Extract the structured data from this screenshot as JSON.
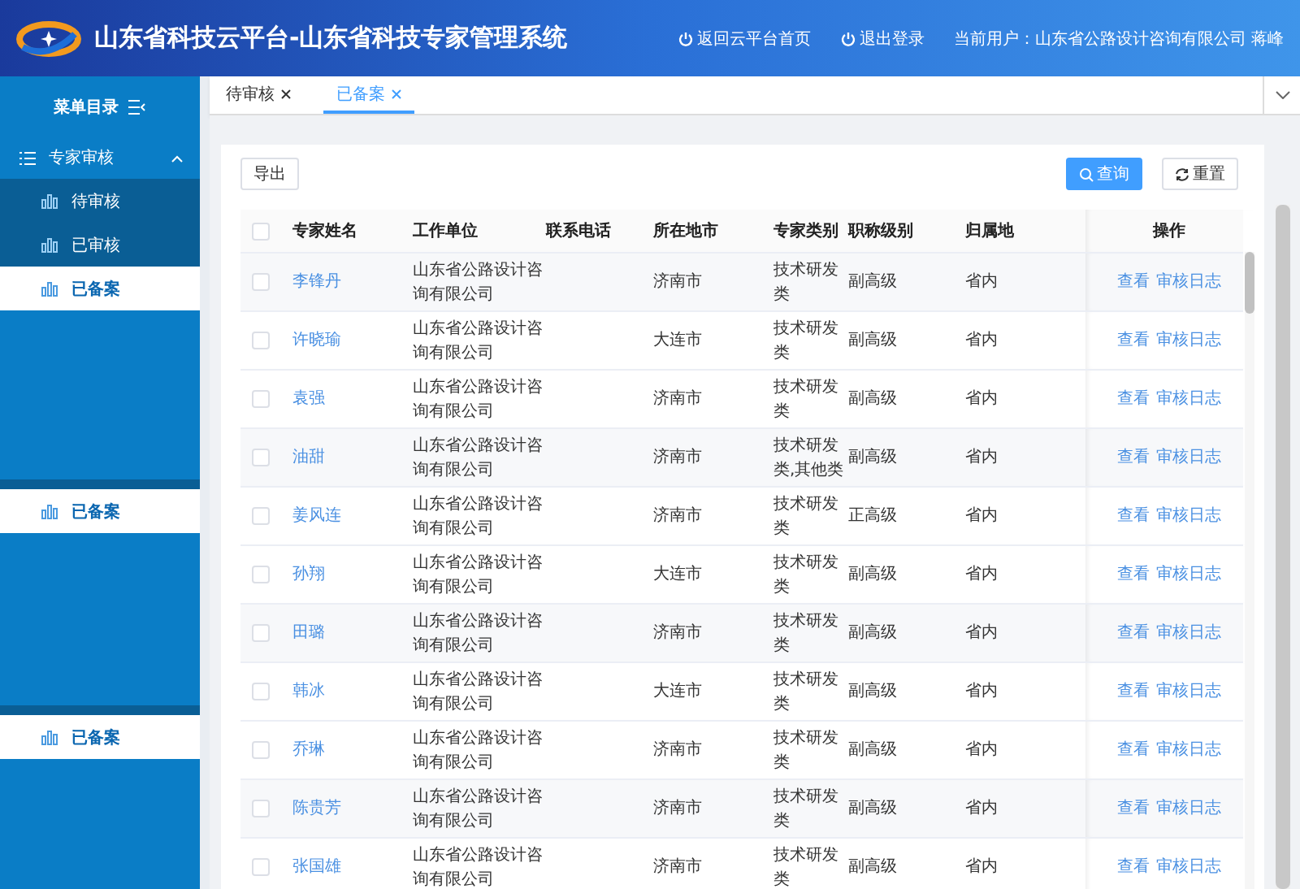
{
  "header": {
    "title": "山东省科技云平台-山东省科技专家管理系统",
    "links": [
      {
        "label": "返回云平台首页"
      },
      {
        "label": "退出登录"
      }
    ],
    "user": "当前用户：山东省公路设计咨询有限公司 蒋峰"
  },
  "sidebar": {
    "title": "菜单目录",
    "groups": [
      {
        "label": "专家审核",
        "expanded": true,
        "children": [
          {
            "label": "待审核",
            "selected": false
          },
          {
            "label": "已审核",
            "selected": false
          },
          {
            "label": "已备案",
            "selected": true
          }
        ]
      }
    ],
    "stray_items": [
      {
        "label": "已备案",
        "selected": true
      },
      {
        "label": "已备案",
        "selected": true
      }
    ]
  },
  "tabs": [
    {
      "label": "待审核",
      "selected": false
    },
    {
      "label": "已备案",
      "selected": true
    }
  ],
  "toolbar": {
    "left": [
      {
        "label": "导出",
        "kind": "plain"
      }
    ],
    "right": [
      {
        "label": "查询",
        "kind": "primary"
      },
      {
        "label": "重置",
        "kind": "reset"
      }
    ]
  },
  "table": {
    "header_checked": false,
    "columns": [
      "专家姓名",
      "工作单位",
      "联系电话",
      "所在地市",
      "专家类别",
      "职称级别",
      "归属地",
      "操作"
    ],
    "rows": [
      {
        "checked": false,
        "name": "李锋丹",
        "unit": "山东省公路设计咨询有限公司",
        "city": "济南市",
        "category": "技术研发类",
        "title": "副高级",
        "region": "省内",
        "actions": [
          "查看",
          "审核日志"
        ]
      },
      {
        "checked": false,
        "name": "许晓瑜",
        "unit": "山东省公路设计咨询有限公司",
        "city": "大连市",
        "category": "技术研发类",
        "title": "副高级",
        "region": "省内",
        "actions": [
          "查看",
          "审核日志"
        ]
      },
      {
        "checked": false,
        "name": "袁强",
        "unit": "山东省公路设计咨询有限公司",
        "city": "济南市",
        "category": "技术研发类",
        "title": "副高级",
        "region": "省内",
        "actions": [
          "查看",
          "审核日志"
        ]
      },
      {
        "checked": false,
        "name": "油甜",
        "unit": "山东省公路设计咨询有限公司",
        "city": "济南市",
        "category": "技术研发类,其他类",
        "title": "副高级",
        "region": "省内",
        "actions": [
          "查看",
          "审核日志"
        ]
      },
      {
        "checked": false,
        "name": "姜风连",
        "unit": "山东省公路设计咨询有限公司",
        "city": "济南市",
        "category": "技术研发类",
        "title": "正高级",
        "region": "省内",
        "actions": [
          "查看",
          "审核日志"
        ]
      },
      {
        "checked": false,
        "name": "孙翔",
        "unit": "山东省公路设计咨询有限公司",
        "city": "大连市",
        "category": "技术研发类",
        "title": "副高级",
        "region": "省内",
        "actions": [
          "查看",
          "审核日志"
        ]
      },
      {
        "checked": false,
        "name": "田璐",
        "unit": "山东省公路设计咨询有限公司",
        "city": "济南市",
        "category": "技术研发类",
        "title": "副高级",
        "region": "省内",
        "actions": [
          "查看",
          "审核日志"
        ]
      },
      {
        "checked": false,
        "name": "韩冰",
        "unit": "山东省公路设计咨询有限公司",
        "city": "大连市",
        "category": "技术研发类",
        "title": "副高级",
        "region": "省内",
        "actions": [
          "查看",
          "审核日志"
        ]
      },
      {
        "checked": false,
        "name": "乔琳",
        "unit": "山东省公路设计咨询有限公司",
        "city": "济南市",
        "category": "技术研发类",
        "title": "副高级",
        "region": "省内",
        "actions": [
          "查看",
          "审核日志"
        ]
      },
      {
        "checked": false,
        "name": "陈贵芳",
        "unit": "山东省公路设计咨询有限公司",
        "city": "济南市",
        "category": "技术研发类",
        "title": "副高级",
        "region": "省内",
        "actions": [
          "查看",
          "审核日志"
        ]
      },
      {
        "checked": false,
        "name": "张国雄",
        "unit": "山东省公路设计咨询有限公司",
        "city": "济南市",
        "category": "技术研发类",
        "title": "副高级",
        "region": "省内",
        "actions": [
          "查看",
          "审核日志"
        ]
      }
    ]
  }
}
